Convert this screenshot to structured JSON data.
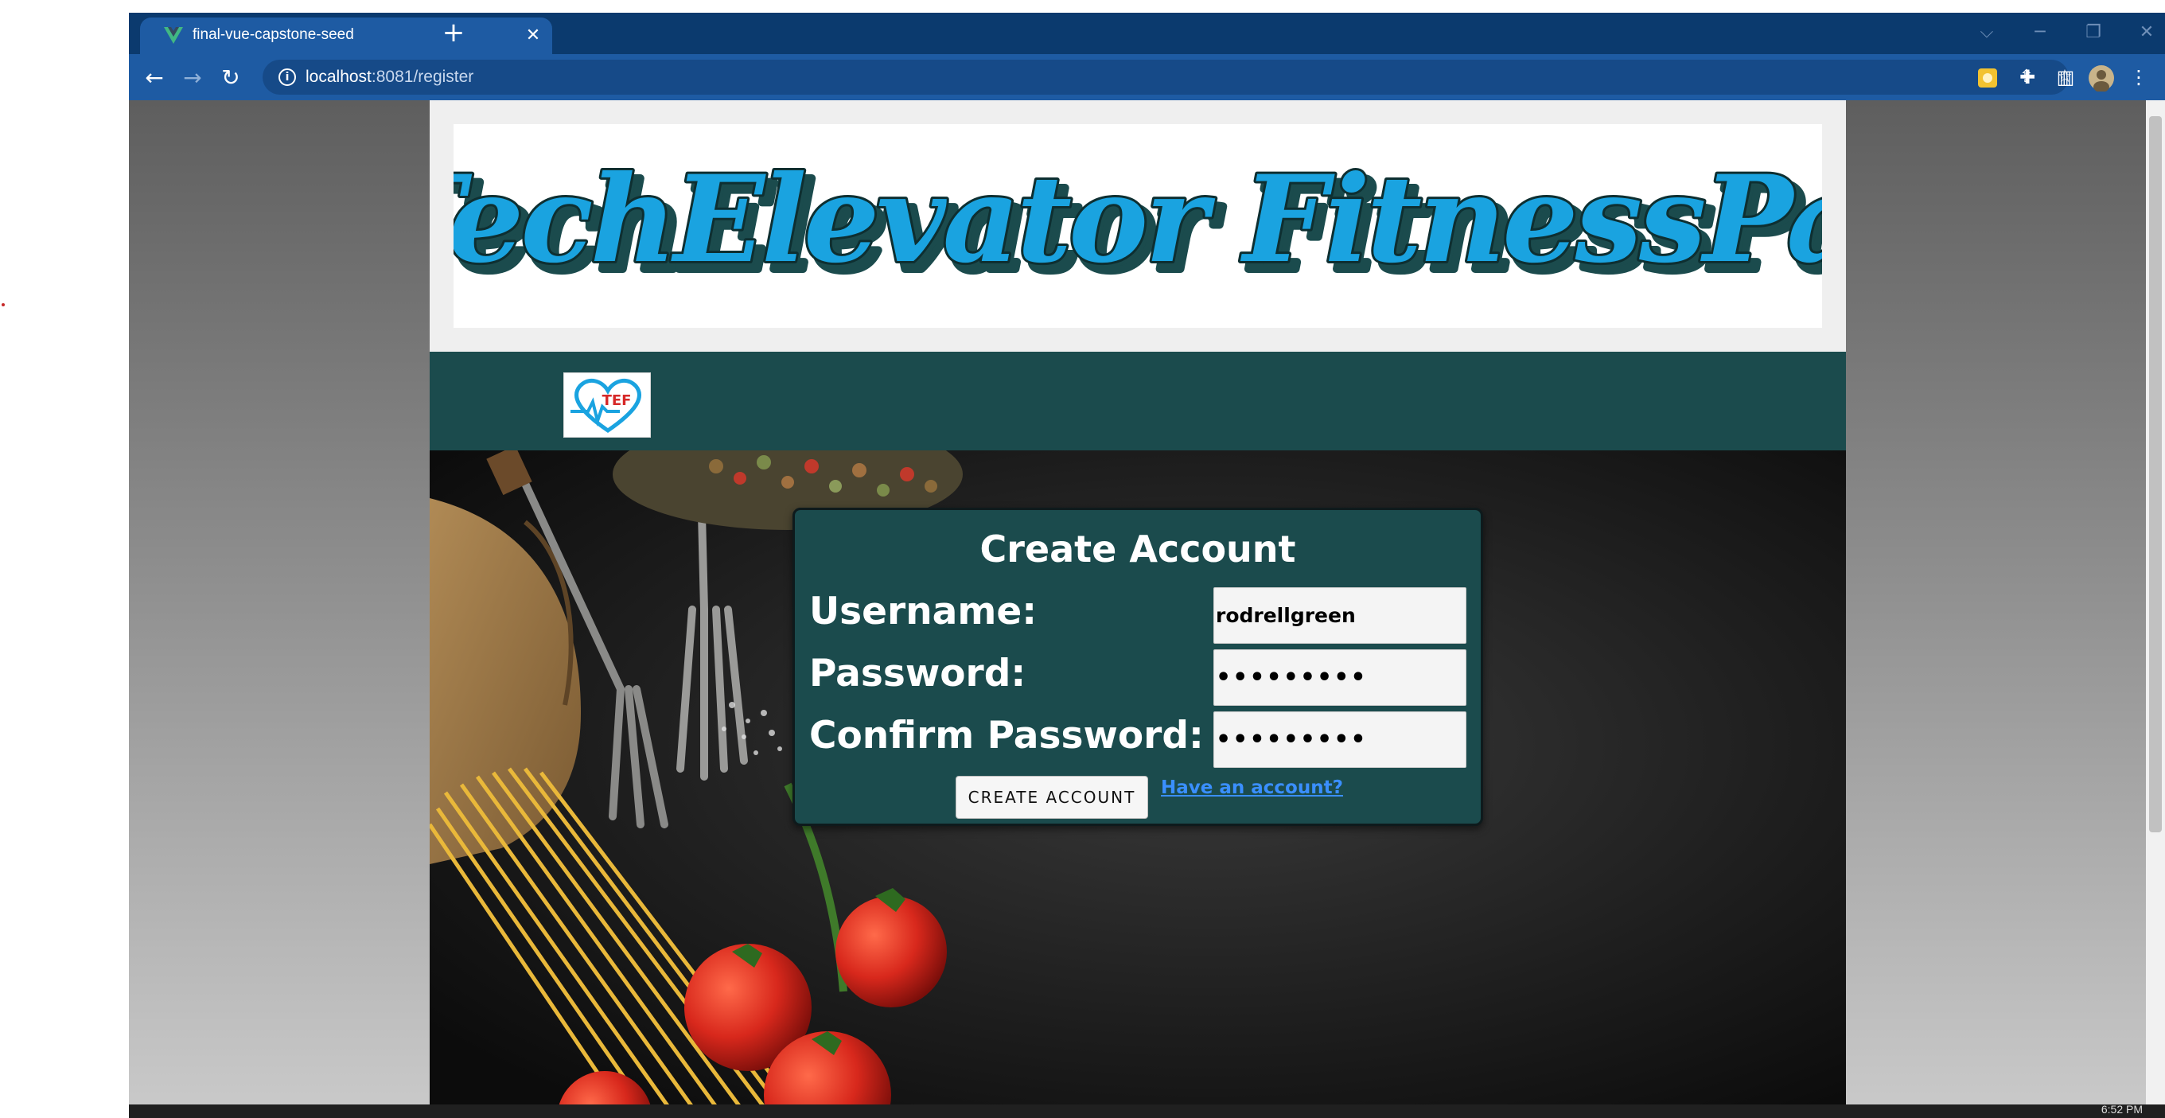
{
  "browser": {
    "tab_title": "final-vue-capstone-seed",
    "tab_close": "✕",
    "new_tab": "+",
    "url_host": "localhost",
    "url_path": ":8081/register",
    "info_glyph": "i",
    "window_controls": {
      "dropdown": "⌵",
      "minimize": "─",
      "restore": "❐",
      "close": "✕"
    },
    "nav": {
      "back": "←",
      "forward": "→",
      "reload": "↻"
    },
    "omnibox_icons": {
      "key": "⚿",
      "share": "⇪",
      "star": "☆"
    },
    "toolbar_icons": {
      "extension": "✚",
      "sidepanel": "▥",
      "menu": "⋮"
    },
    "accent_colors": {
      "tab_strip": "#0b3a6e",
      "toolbar": "#1e5ba3",
      "vue_green": "#41b883"
    }
  },
  "page": {
    "banner_title": "TechElevator FitnessPal",
    "logo_text": "TEF",
    "colors": {
      "header_teal": "#1b4b4d",
      "logo_blue": "#1aa3e0",
      "logo_red": "#d62828"
    }
  },
  "form": {
    "title": "Create Account",
    "username_label": "Username:",
    "password_label": "Password:",
    "confirm_label": "Confirm Password:",
    "username_value": "rodrellgreen",
    "password_value": "•••••••••",
    "confirm_value": "•••••••••",
    "submit_label": "CREATE ACCOUNT",
    "login_link": "Have an account?"
  },
  "taskbar": {
    "clock": "6:52 PM"
  }
}
